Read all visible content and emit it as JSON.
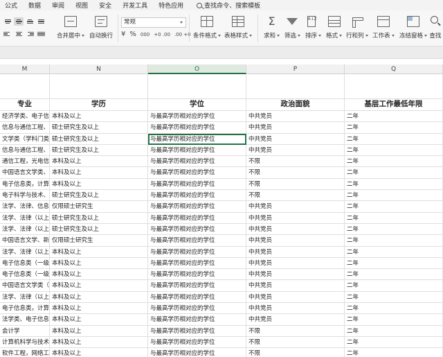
{
  "menu": {
    "items": [
      "公式",
      "数据",
      "审阅",
      "视图",
      "安全",
      "开发工具",
      "特色应用"
    ],
    "search_label": "查找命令、搜索模板"
  },
  "ribbon": {
    "merge_label": "合并居中",
    "wrap_label": "自动换行",
    "number_format": "常规",
    "currency_symbol": "¥",
    "percent_symbol": "%",
    "thousands_symbol": "000",
    "inc_decimal": "+0 .00",
    "dec_decimal": ".00 +0",
    "conditional_format_label": "条件格式",
    "table_style_label": "表格样式",
    "sum_label": "求和",
    "filter_label": "筛选",
    "sort_label": "排序",
    "format_label": "格式",
    "rowcol_label": "行和列",
    "sheet_label": "工作表",
    "freeze_label": "冻结窗格",
    "find_label": "查找",
    "sum_glyph": "Σ",
    "sort_glyph": "A↓Z"
  },
  "columns": [
    {
      "letter": "M",
      "selected": false
    },
    {
      "letter": "N",
      "selected": false
    },
    {
      "letter": "O",
      "selected": true
    },
    {
      "letter": "P",
      "selected": false
    },
    {
      "letter": "Q",
      "selected": false
    }
  ],
  "headers": [
    "专业",
    "学历",
    "学位",
    "政治面貌",
    "基层工作最低年限"
  ],
  "rows": [
    [
      "经济学类、电子信息",
      "本科及以上",
      "与最高学历相对应的学位",
      "中共党员",
      "二年"
    ],
    [
      "信息与通信工程、计算",
      "硕士研究生及以上",
      "与最高学历相对应的学位",
      "中共党员",
      "二年"
    ],
    [
      "文学类（学科门类）",
      "硕士研究生及以上",
      "与最高学历相对应的学位",
      "中共党员",
      "二年"
    ],
    [
      "信息与通信工程、计算",
      "硕士研究生及以上",
      "与最高学历相对应的学位",
      "中共党员",
      "二年"
    ],
    [
      "通信工程，光电信息",
      "本科及以上",
      "与最高学历相对应的学位",
      "不限",
      "二年"
    ],
    [
      "中国语言文学类、新闻",
      "本科及以上",
      "与最高学历相对应的学位",
      "不限",
      "二年"
    ],
    [
      "电子信息类，计算机类",
      "本科及以上",
      "与最高学历相对应的学位",
      "不限",
      "二年"
    ],
    [
      "电子科学与技术、信息",
      "硕士研究生及以上",
      "与最高学历相对应的学位",
      "不限",
      "二年"
    ],
    [
      "法学、法律、信息与",
      "仅限硕士研究生",
      "与最高学历相对应的学位",
      "中共党员",
      "二年"
    ],
    [
      "法学、法律（以上均",
      "硕士研究生及以上",
      "与最高学历相对应的学位",
      "中共党员",
      "二年"
    ],
    [
      "法学、法律（以上均",
      "硕士研究生及以上",
      "与最高学历相对应的学位",
      "中共党员",
      "二年"
    ],
    [
      "中国语言文学、新闻学",
      "仅限硕士研究生",
      "与最高学历相对应的学位",
      "中共党员",
      "二年"
    ],
    [
      "法学、法律（以上均",
      "本科及以上",
      "与最高学历相对应的学位",
      "中共党员",
      "二年"
    ],
    [
      "电子信息类（一级学科",
      "本科及以上",
      "与最高学历相对应的学位",
      "中共党员",
      "二年"
    ],
    [
      "电子信息类（一级学科",
      "本科及以上",
      "与最高学历相对应的学位",
      "中共党员",
      "二年"
    ],
    [
      "中国语言文学类（一级",
      "本科及以上",
      "与最高学历相对应的学位",
      "中共党员",
      "二年"
    ],
    [
      "法学、法律（以上均",
      "本科及以上",
      "与最高学历相对应的学位",
      "中共党员",
      "二年"
    ],
    [
      "电子信息类，计算机类",
      "本科及以上",
      "与最高学历相对应的学位",
      "中共党员",
      "二年"
    ],
    [
      "法学类、电子信息类",
      "本科及以上",
      "与最高学历相对应的学位",
      "中共党员",
      "二年"
    ],
    [
      "会计学",
      "本科及以上",
      "与最高学历相对应的学位",
      "不限",
      "二年"
    ],
    [
      "计算机科学与技术、软",
      "本科及以上",
      "与最高学历相对应的学位",
      "不限",
      "二年"
    ],
    [
      "软件工程，网络工程",
      "本科及以上",
      "与最高学历相对应的学位",
      "不限",
      "二年"
    ]
  ],
  "selected_cell": {
    "row": 2,
    "col": 2
  },
  "colors": {
    "accent": "#217346",
    "grid_line": "#dedede",
    "header_bg": "#f1f1f1"
  }
}
